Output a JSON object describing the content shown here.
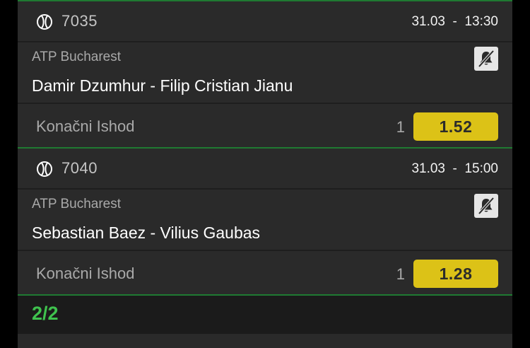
{
  "events": [
    {
      "sport_icon": "tennis-ball-icon",
      "code": "7035",
      "datetime": "31.03  -  13:30",
      "league": "ATP Bucharest",
      "match": "Damir Dzumhur - Filip Cristian Jianu",
      "notification_icon": "bell-off-icon",
      "market": "Konačni Ishod",
      "outcome": "1",
      "odds": "1.52"
    },
    {
      "sport_icon": "tennis-ball-icon",
      "code": "7040",
      "datetime": "31.03  -  15:00",
      "league": "ATP Bucharest",
      "match": "Sebastian Baez - Vilius Gaubas",
      "notification_icon": "bell-off-icon",
      "market": "Konačni Ishod",
      "outcome": "1",
      "odds": "1.28"
    }
  ],
  "pager": {
    "text": "2/2"
  },
  "colors": {
    "background": "#000000",
    "card": "#2a2a2a",
    "accent_green": "#1f7a32",
    "pager_text": "#3fc24e",
    "odds_button": "#dcc217"
  }
}
